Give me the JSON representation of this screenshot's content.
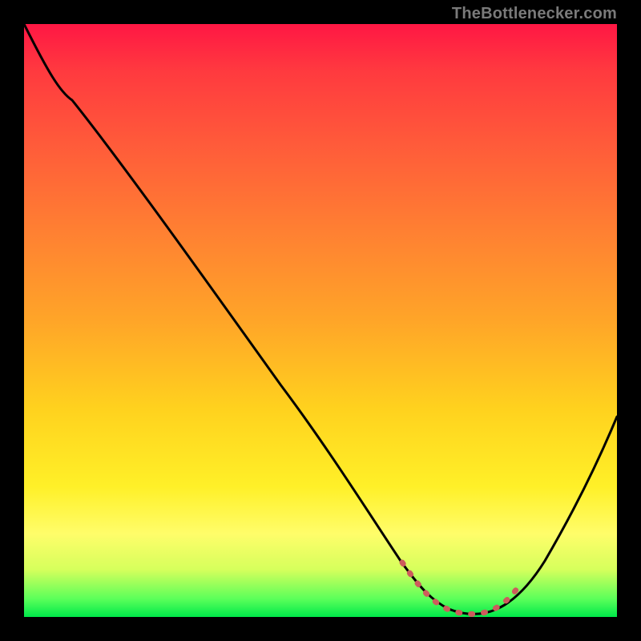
{
  "watermark": {
    "text": "TheBottlenecker.com"
  },
  "chart_data": {
    "type": "line",
    "title": "",
    "xlabel": "",
    "ylabel": "",
    "x": [
      0,
      5,
      10,
      15,
      20,
      25,
      30,
      35,
      40,
      45,
      50,
      55,
      60,
      63,
      66,
      70,
      73,
      76,
      80,
      85,
      90,
      95,
      100
    ],
    "values": [
      99,
      95,
      89,
      81,
      73,
      65,
      57,
      49,
      41,
      33,
      25,
      18,
      11,
      6,
      3,
      1,
      0,
      0,
      2,
      8,
      16,
      25,
      35
    ],
    "xlim": [
      0,
      100
    ],
    "ylim": [
      0,
      100
    ],
    "note": "Axis-free bottleneck plot. x ≈ horizontal position (% of inner width), values ≈ vertical height from bottom (% of inner height). Minimum (zero bottleneck) occurs around x≈73–76%. A short salmon-colored dotted segment highlights the minimum region."
  },
  "colors": {
    "curve": "#000000",
    "highlight": "#cd5c5c",
    "background_black": "#000000"
  }
}
